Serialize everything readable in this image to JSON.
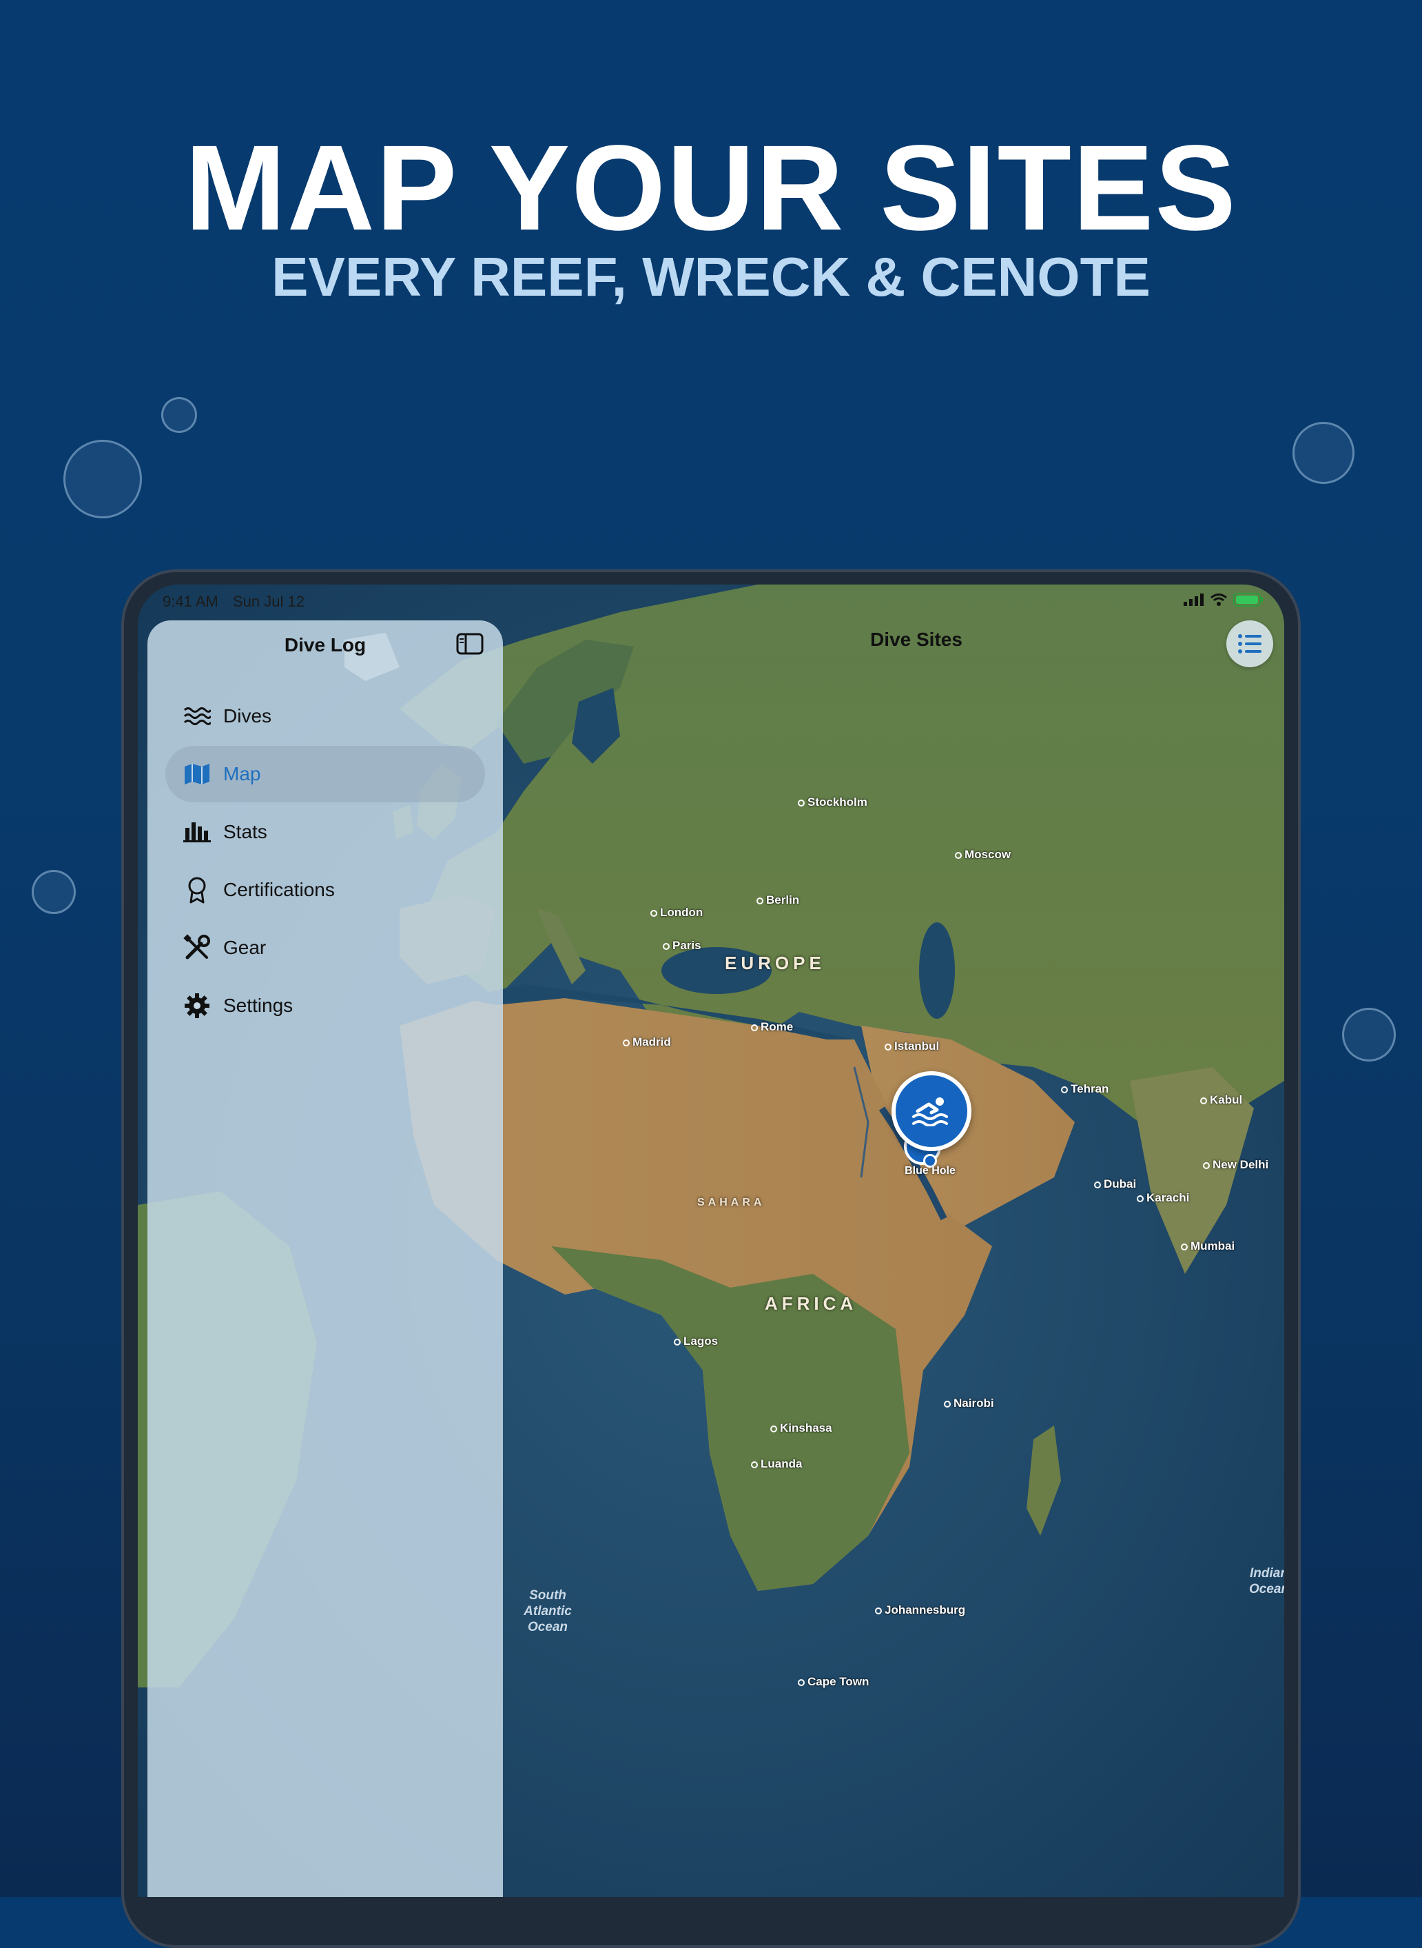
{
  "hero": {
    "title": "MAP YOUR SITES",
    "subtitle": "EVERY REEF, WRECK & CENOTE"
  },
  "status_bar": {
    "time": "9:41 AM",
    "date": "Sun Jul 12"
  },
  "sidebar": {
    "title": "Dive Log",
    "items": [
      {
        "label": "Dives",
        "icon": "waves-icon",
        "active": false
      },
      {
        "label": "Map",
        "icon": "map-icon",
        "active": true
      },
      {
        "label": "Stats",
        "icon": "bar-chart-icon",
        "active": false
      },
      {
        "label": "Certifications",
        "icon": "ribbon-icon",
        "active": false
      },
      {
        "label": "Gear",
        "icon": "tools-icon",
        "active": false
      },
      {
        "label": "Settings",
        "icon": "gear-icon",
        "active": false
      }
    ]
  },
  "map": {
    "title": "Dive Sites",
    "pin_label": "Blue Hole",
    "cities": [
      {
        "name": "Stockholm"
      },
      {
        "name": "Moscow"
      },
      {
        "name": "London"
      },
      {
        "name": "Berlin"
      },
      {
        "name": "Paris"
      },
      {
        "name": "Madrid"
      },
      {
        "name": "Rome"
      },
      {
        "name": "Istanbul"
      },
      {
        "name": "Tehran"
      },
      {
        "name": "Kabul"
      },
      {
        "name": "New Delhi"
      },
      {
        "name": "Dubai"
      },
      {
        "name": "Karachi"
      },
      {
        "name": "Mumbai"
      },
      {
        "name": "Lagos"
      },
      {
        "name": "Nairobi"
      },
      {
        "name": "Kinshasa"
      },
      {
        "name": "Luanda"
      },
      {
        "name": "Johannesburg"
      },
      {
        "name": "Cape Town"
      }
    ],
    "regions": {
      "europe": "EUROPE",
      "africa": "AFRICA",
      "sahara": "SAHARA"
    },
    "oceans": {
      "south_atlantic": "South Atlantic Ocean",
      "indian": "Indian Ocean"
    }
  },
  "colors": {
    "background": "#073a6e",
    "accent": "#1565c0",
    "subtitle": "#bcd9f3"
  }
}
